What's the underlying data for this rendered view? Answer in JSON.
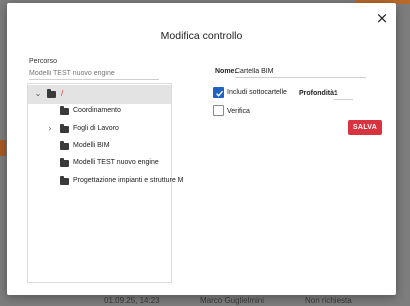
{
  "background": {
    "row_texts": [
      "01.09.25, 14:23",
      "Marco Guglielmini",
      "Non richiesta"
    ]
  },
  "dialog": {
    "title": "Modifica controllo",
    "close_icon": "×"
  },
  "path": {
    "label": "Percorso",
    "placeholder": "Modelli TEST nuovo engine"
  },
  "tree": {
    "root": {
      "label": "/",
      "expanded": true
    },
    "items": [
      {
        "label": "Coordinamento",
        "has_children": false
      },
      {
        "label": "Fogli di Lavoro",
        "has_children": true
      },
      {
        "label": "Modelli BIM",
        "has_children": false
      },
      {
        "label": "Modelli TEST nuovo engine",
        "has_children": false
      },
      {
        "label": "Progettazione impianti e strutture M",
        "has_children": false
      }
    ],
    "expanded_chevron": "⌄",
    "collapsed_chevron": "›"
  },
  "form": {
    "name_label": "Nome:",
    "name_value": "Cartella BIM",
    "include_subfolders_label": "Includi sottocartelle",
    "include_subfolders_checked": true,
    "depth_label": "Profondità:",
    "depth_value": "1",
    "verify_label": "Verifica",
    "verify_checked": false,
    "save_label": "SALVA"
  },
  "colors": {
    "accent_blue": "#1e63c4",
    "save_red": "#d8333f",
    "root_slash_red": "#e0302a"
  }
}
